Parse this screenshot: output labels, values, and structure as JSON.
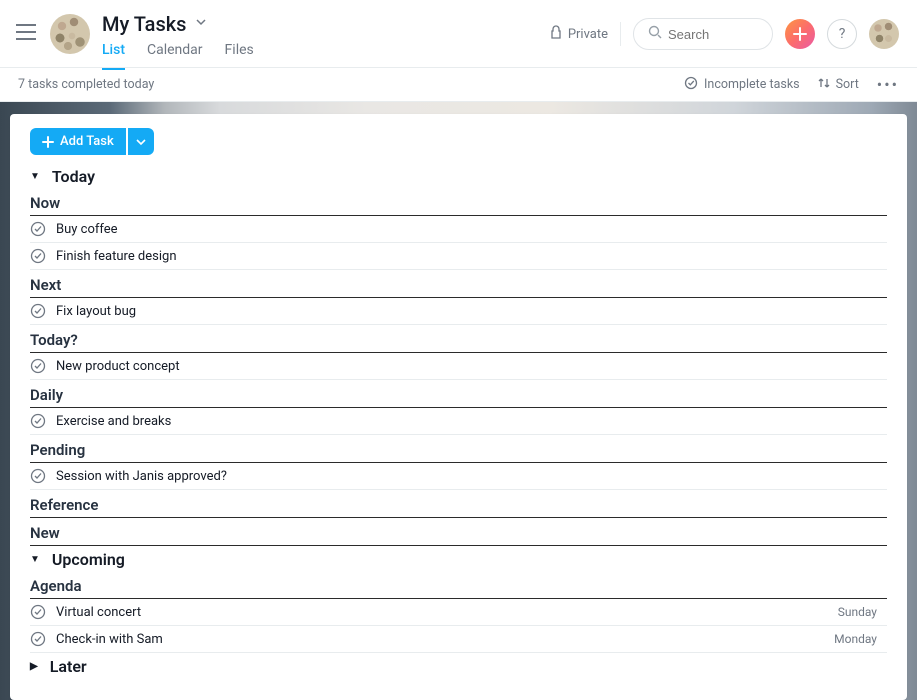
{
  "header": {
    "title": "My Tasks",
    "tabs": [
      "List",
      "Calendar",
      "Files"
    ],
    "active_tab": 0,
    "privacy": "Private",
    "search_placeholder": "Search"
  },
  "subbar": {
    "status": "7 tasks completed today",
    "filter_label": "Incomplete tasks",
    "sort_label": "Sort"
  },
  "add_task_label": "Add Task",
  "sections": [
    {
      "title": "Today",
      "collapsed": false,
      "groups": [
        {
          "heading": "Now",
          "tasks": [
            {
              "text": "Buy coffee"
            },
            {
              "text": "Finish feature design"
            }
          ]
        },
        {
          "heading": "Next",
          "tasks": [
            {
              "text": "Fix layout bug"
            }
          ]
        },
        {
          "heading": "Today?",
          "tasks": [
            {
              "text": "New product concept"
            }
          ]
        },
        {
          "heading": "Daily",
          "tasks": [
            {
              "text": "Exercise and breaks"
            }
          ]
        },
        {
          "heading": "Pending",
          "tasks": [
            {
              "text": "Session with Janis approved?"
            }
          ]
        },
        {
          "heading": "Reference",
          "tasks": []
        },
        {
          "heading": "New",
          "tasks": []
        }
      ]
    },
    {
      "title": "Upcoming",
      "collapsed": false,
      "groups": [
        {
          "heading": "Agenda",
          "tasks": [
            {
              "text": "Virtual concert",
              "due": "Sunday"
            },
            {
              "text": "Check-in with Sam",
              "due": "Monday"
            }
          ]
        }
      ]
    },
    {
      "title": "Later",
      "collapsed": true,
      "groups": []
    }
  ]
}
